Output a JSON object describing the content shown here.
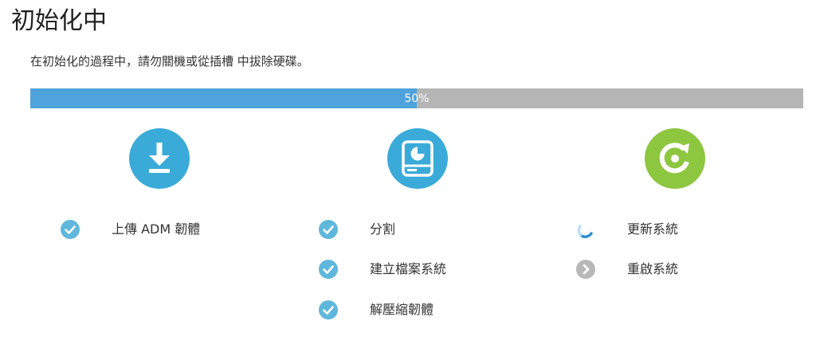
{
  "page": {
    "title": "初始化中",
    "subtitle": "在初始化的過程中，請勿關機或從插槽 中拔除硬碟。"
  },
  "progress": {
    "value": 0.5,
    "label": "50%",
    "fill_color": "#4fa3dc",
    "track_color": "#b5b5b5"
  },
  "stages": [
    {
      "icon": "download-icon",
      "color": "#3aabd9",
      "steps": [
        {
          "label": "上傳 ADM 韌體",
          "status": "done",
          "status_icon": "check-circle-icon"
        }
      ]
    },
    {
      "icon": "disk-partition-icon",
      "color": "#3aabd9",
      "steps": [
        {
          "label": "分割",
          "status": "done",
          "status_icon": "check-circle-icon"
        },
        {
          "label": "建立檔案系統",
          "status": "done",
          "status_icon": "check-circle-icon"
        },
        {
          "label": "解壓縮韌體",
          "status": "done",
          "status_icon": "check-circle-icon"
        }
      ]
    },
    {
      "icon": "restart-icon",
      "color": "#8dc63f",
      "steps": [
        {
          "label": "更新系統",
          "status": "in-progress",
          "status_icon": "loading-spinner-icon"
        },
        {
          "label": "重啟系統",
          "status": "pending",
          "status_icon": "chevron-right-circle-icon"
        }
      ]
    }
  ],
  "colors": {
    "check": "#5fb7dc",
    "pending": "#b8b8b8",
    "spinner": "#2f8fd1"
  }
}
